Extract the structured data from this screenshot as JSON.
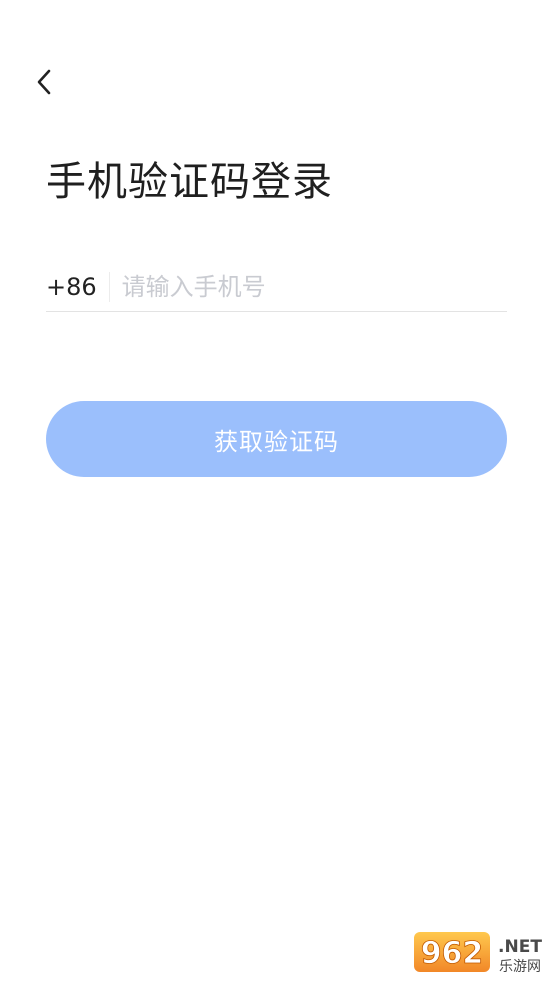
{
  "header": {
    "back_icon": "chevron-left-icon"
  },
  "page": {
    "title": "手机验证码登录"
  },
  "phone": {
    "country_code": "+86",
    "value": "",
    "placeholder": "请输入手机号"
  },
  "actions": {
    "get_code_label": "获取验证码",
    "button_color": "#9bbffc"
  },
  "watermark": {
    "brand": "962.NET",
    "subtitle": "乐游网"
  }
}
